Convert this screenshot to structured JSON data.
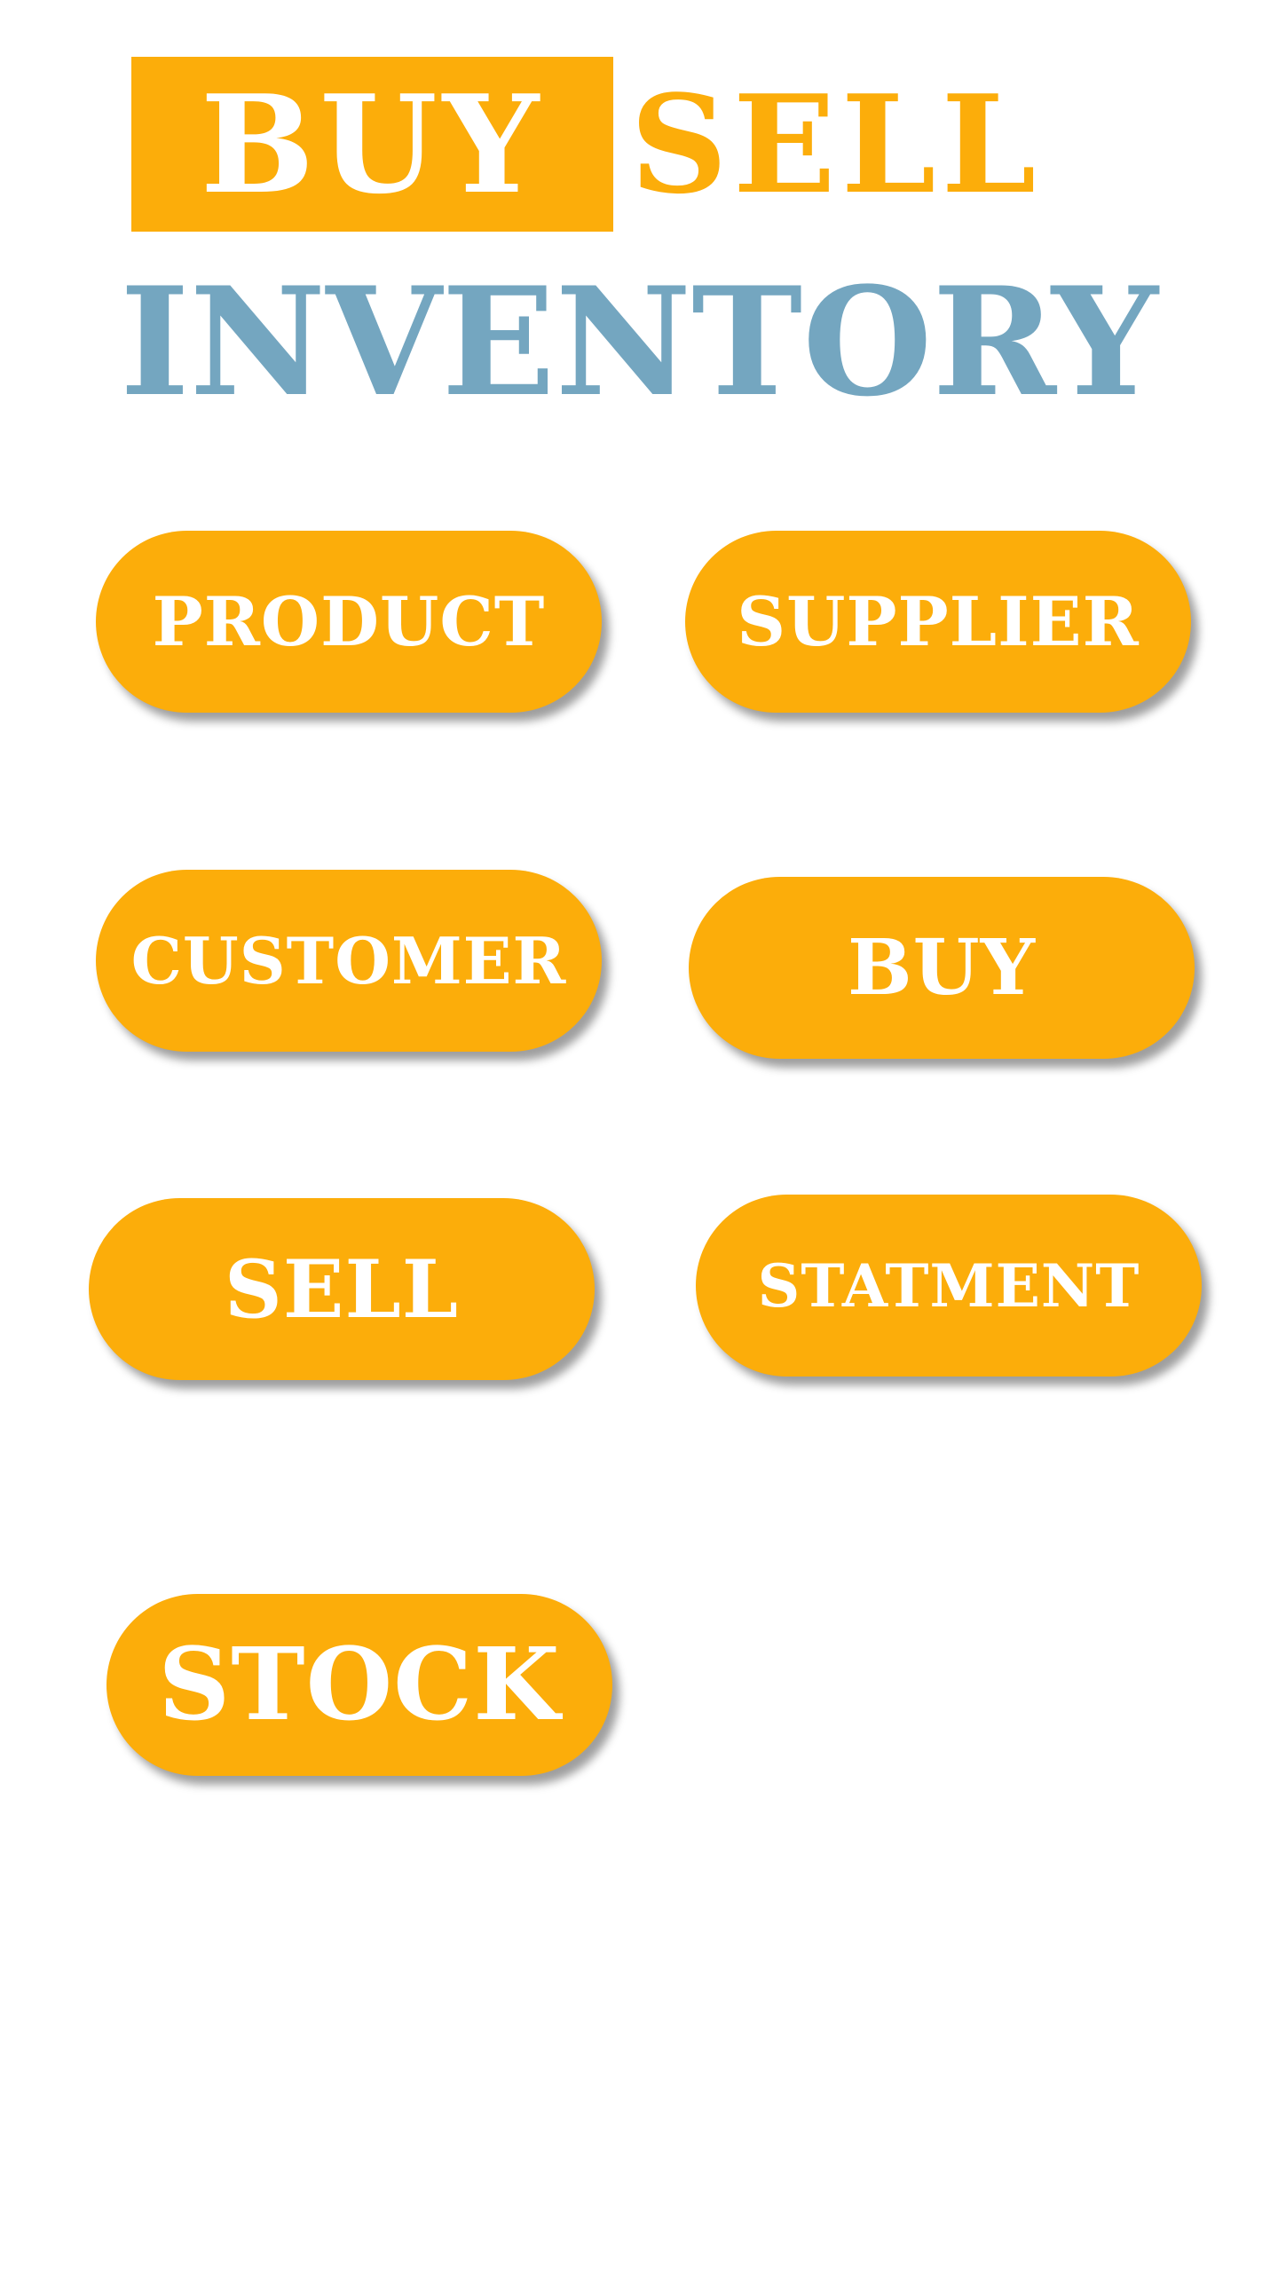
{
  "logo": {
    "buy": "BUY",
    "sell": "SELL",
    "inventory": "INVENTORY"
  },
  "menu": {
    "product": "PRODUCT",
    "supplier": "SUPPLIER",
    "customer": "CUSTOMER",
    "buy": "BUY",
    "sell": "SELL",
    "statment": "STATMENT",
    "stock": "STOCK"
  },
  "colors": {
    "accent": "#FCAD0A",
    "logo_blue": "#74A6C0",
    "text_on_accent": "#FFFFFF",
    "background": "#FFFFFF"
  }
}
